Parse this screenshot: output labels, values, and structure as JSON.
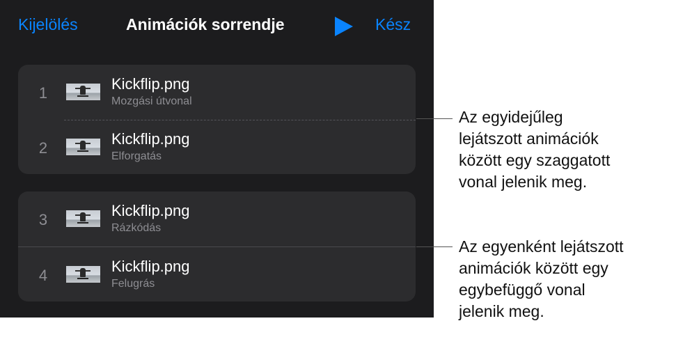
{
  "nav": {
    "left_label": "Kijelölés",
    "title": "Animációk sorrendje",
    "play_icon": "play-icon",
    "right_label": "Kész"
  },
  "groups": [
    {
      "separator": "dashed",
      "rows": [
        {
          "number": "1",
          "title": "Kickflip.png",
          "subtitle": "Mozgási útvonal"
        },
        {
          "number": "2",
          "title": "Kickflip.png",
          "subtitle": "Elforgatás"
        }
      ]
    },
    {
      "separator": "solid",
      "rows": [
        {
          "number": "3",
          "title": "Kickflip.png",
          "subtitle": "Rázkódás"
        },
        {
          "number": "4",
          "title": "Kickflip.png",
          "subtitle": "Felugrás"
        }
      ]
    }
  ],
  "callouts": {
    "dashed": [
      "Az egyidejűleg",
      "lejátszott animációk",
      "között egy szaggatott",
      "vonal jelenik meg."
    ],
    "solid": [
      "Az egyenként lejátszott",
      "animációk között egy",
      "egybefüggő vonal",
      "jelenik meg."
    ]
  },
  "colors": {
    "accent": "#0a84ff",
    "panel_bg": "#1c1c1e",
    "group_bg": "#2c2c2e",
    "secondary_text": "#8e8e93"
  }
}
